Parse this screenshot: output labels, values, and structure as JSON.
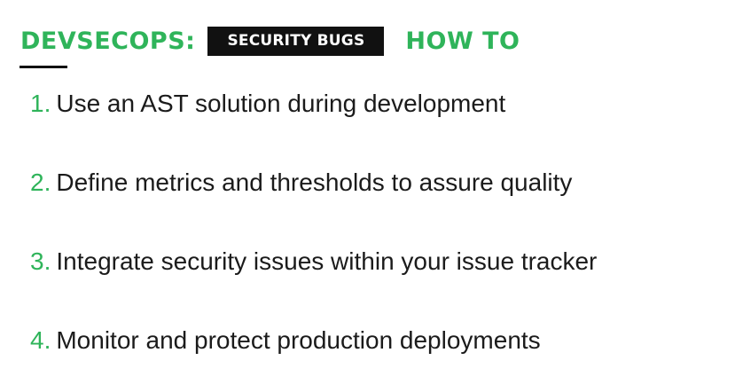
{
  "header": {
    "brand": "DEVSECOPS:",
    "tag": "SECURITY BUGS",
    "section": "HOW TO"
  },
  "colors": {
    "accent": "#2fb45a",
    "text": "#1b1b1b",
    "tag_bg": "#111111"
  },
  "steps": [
    {
      "num": "1.",
      "text": "Use an AST solution during development"
    },
    {
      "num": "2.",
      "text": "Define metrics and thresholds to assure quality"
    },
    {
      "num": "3.",
      "text": "Integrate security issues within your issue tracker"
    },
    {
      "num": "4.",
      "text": "Monitor and protect production deployments"
    }
  ]
}
